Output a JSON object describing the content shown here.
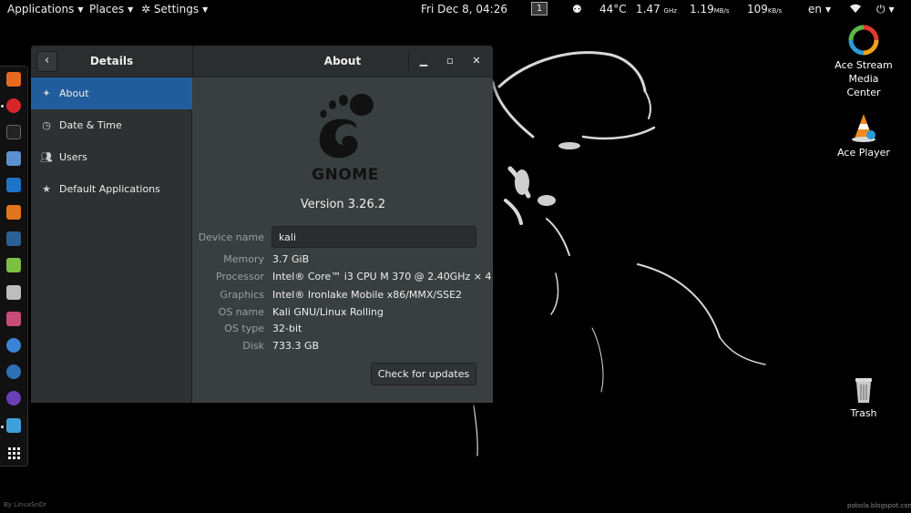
{
  "topbar": {
    "applications": "Applications",
    "places": "Places",
    "settings": "Settings",
    "clock": "Fri Dec  8, 04:26",
    "workspace": "1",
    "temperature": "44°C",
    "cpu_freq": "1.47",
    "cpu_unit": "GHz",
    "net_down": "1.19",
    "net_down_unit": "MB/s",
    "net_up": "109",
    "net_up_unit": "KB/s",
    "language": "en"
  },
  "dock": {
    "icons": [
      "firefox-icon",
      "opera-icon",
      "terminal-icon",
      "files-icon",
      "metasploit-icon",
      "burpsuite-icon",
      "maltego-icon",
      "notes-icon",
      "disk-icon",
      "settings-icon",
      "browser-icon",
      "screenshot-icon",
      "media-player-icon",
      "ace-stream-icon",
      "app-grid-icon"
    ]
  },
  "window": {
    "left_title": "Details",
    "right_title": "About",
    "sidebar": [
      {
        "label": "About",
        "icon": "sparkle-icon",
        "active": true
      },
      {
        "label": "Date & Time",
        "icon": "clock-icon",
        "active": false
      },
      {
        "label": "Users",
        "icon": "users-icon",
        "active": false
      },
      {
        "label": "Default Applications",
        "icon": "star-icon",
        "active": false
      }
    ],
    "about": {
      "logo_text": "GNOME",
      "version": "Version 3.26.2",
      "device_name_label": "Device name",
      "device_name_value": "kali",
      "memory_label": "Memory",
      "memory_value": "3.7 GiB",
      "processor_label": "Processor",
      "processor_value": "Intel® Core™ i3 CPU M 370 @ 2.40GHz × 4",
      "graphics_label": "Graphics",
      "graphics_value": "Intel® Ironlake Mobile x86/MMX/SSE2",
      "os_name_label": "OS name",
      "os_name_value": "Kali GNU/Linux Rolling",
      "os_type_label": "OS type",
      "os_type_value": "32-bit",
      "disk_label": "Disk",
      "disk_value": "733.3 GB",
      "check_updates": "Check for updates"
    }
  },
  "desktop": {
    "icons": [
      {
        "label_1": "Ace Stream",
        "label_2": "Media",
        "label_3": "Center"
      },
      {
        "label_1": "Ace Player"
      },
      {
        "label_1": "Trash"
      }
    ]
  },
  "footer": {
    "left": "By LinuxSnDr",
    "right": "pobola.blogspot.com"
  },
  "colors": {
    "selection": "#215d9c",
    "window_bg": "#393f3f",
    "sidebar_bg": "#2d3131",
    "titlebar_bg": "#2b2e2e"
  }
}
